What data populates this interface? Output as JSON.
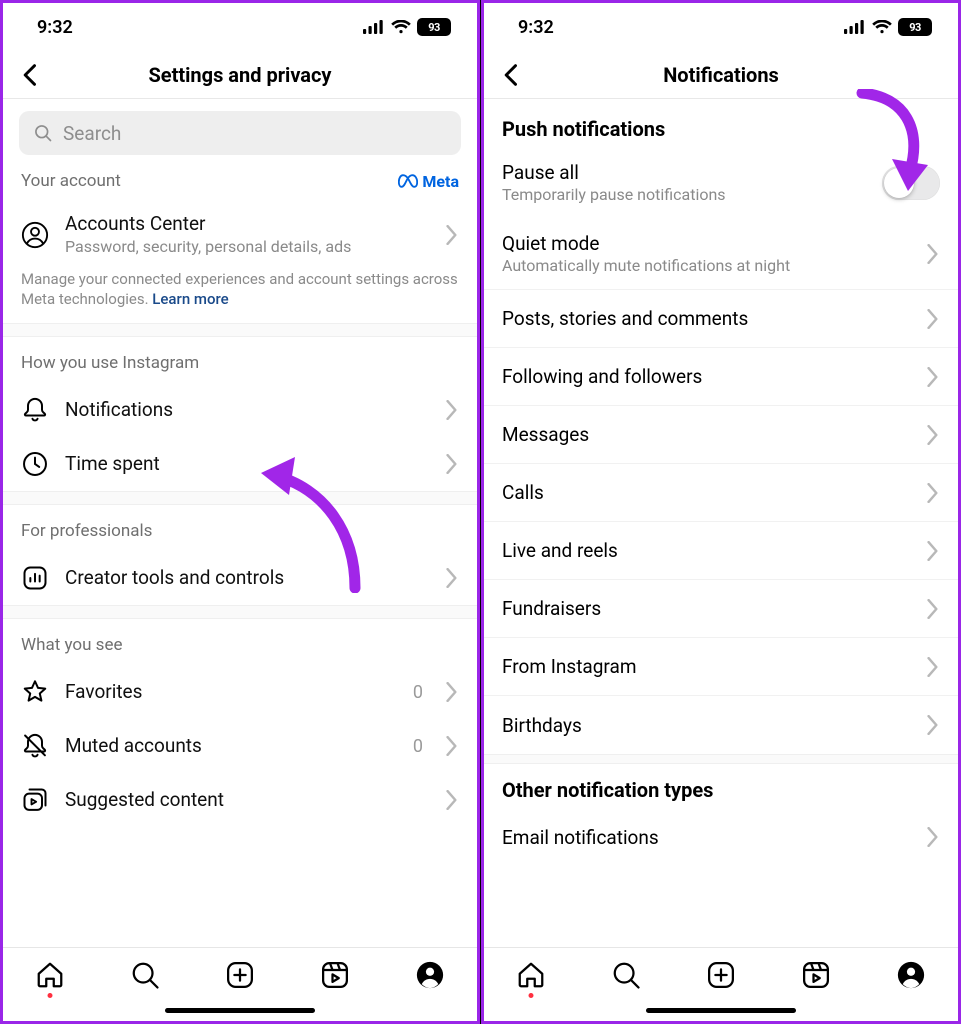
{
  "status": {
    "time": "9:32",
    "battery": "93"
  },
  "left": {
    "title": "Settings and privacy",
    "search_placeholder": "Search",
    "meta_label": "Meta",
    "your_account": "Your account",
    "accounts_center": "Accounts Center",
    "accounts_center_sub": "Password, security, personal details, ads",
    "manage_note": "Manage your connected experiences and account settings across Meta technologies. ",
    "learn_more": "Learn more",
    "how_you_use": "How you use Instagram",
    "notifications": "Notifications",
    "time_spent": "Time spent",
    "for_professionals": "For professionals",
    "creator_tools": "Creator tools and controls",
    "what_you_see": "What you see",
    "favorites": "Favorites",
    "favorites_count": "0",
    "muted": "Muted accounts",
    "muted_count": "0",
    "suggested": "Suggested content"
  },
  "right": {
    "title": "Notifications",
    "push_heading": "Push notifications",
    "pause_all": "Pause all",
    "pause_all_sub": "Temporarily pause notifications",
    "quiet_mode": "Quiet mode",
    "quiet_mode_sub": "Automatically mute notifications at night",
    "items": {
      "posts": "Posts, stories and comments",
      "following": "Following and followers",
      "messages": "Messages",
      "calls": "Calls",
      "live": "Live and reels",
      "fundraisers": "Fundraisers",
      "from_ig": "From Instagram",
      "birthdays": "Birthdays"
    },
    "other_heading": "Other notification types",
    "email": "Email notifications"
  }
}
